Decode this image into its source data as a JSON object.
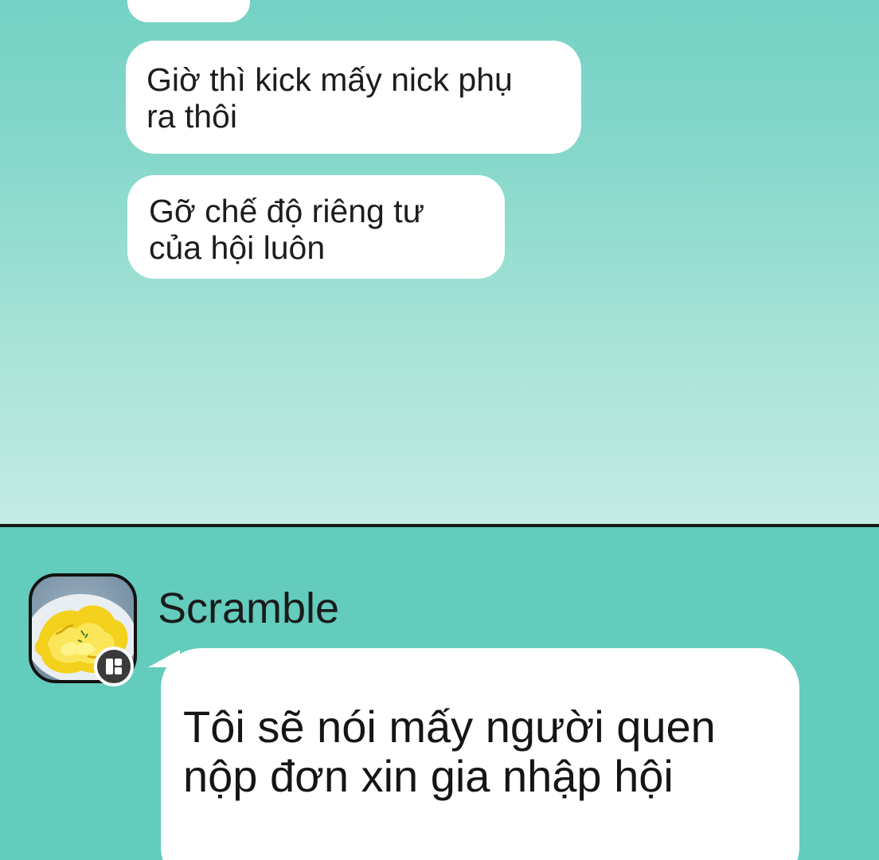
{
  "chat_top": {
    "messages": [
      {
        "lines": [
          "Giờ thì kick mấy nick phụ",
          "ra thôi"
        ]
      },
      {
        "lines": [
          "Gỡ chế độ riêng tư",
          "của hội luôn"
        ]
      }
    ]
  },
  "chat_bottom": {
    "sender": {
      "name": "Scramble",
      "avatar": "scrambled-eggs-avatar",
      "badge_icon": "leader-badge-icon"
    },
    "message": {
      "lines": [
        "Tôi sẽ nói mấy người quen",
        "nộp đơn xin gia nhập hội"
      ]
    }
  },
  "colors": {
    "top_background": "#86d8cb",
    "bottom_background": "#63ccbc",
    "bubble": "#ffffff",
    "divider": "#151a19"
  }
}
